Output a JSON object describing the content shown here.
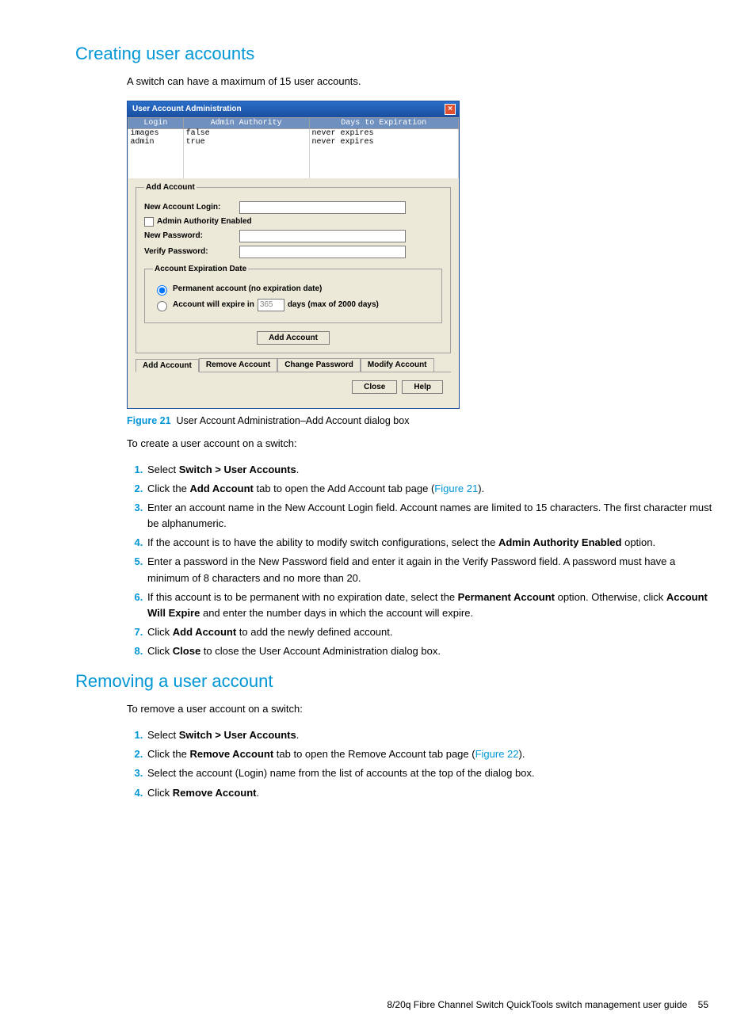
{
  "section1": {
    "heading": "Creating user accounts",
    "intro": "A switch can have a maximum of 15 user accounts."
  },
  "dialog": {
    "title": "User Account Administration",
    "columns": [
      "Login",
      "Admin Authority",
      "Days to Expiration"
    ],
    "rows": [
      {
        "login": "images",
        "auth": "false",
        "exp": "never expires"
      },
      {
        "login": "admin",
        "auth": "true",
        "exp": "never expires"
      }
    ],
    "addAccountLegend": "Add Account",
    "newLoginLabel": "New Account Login:",
    "adminAuthLabel": "Admin Authority Enabled",
    "newPasswordLabel": "New Password:",
    "verifyPasswordLabel": "Verify Password:",
    "expLegend": "Account Expiration Date",
    "permanentLabel": "Permanent account (no expiration date)",
    "expireLabel": "Account will expire in",
    "daysDefault": "365",
    "daysMax": "days (max of 2000 days)",
    "addButton": "Add Account",
    "tabs": [
      "Add Account",
      "Remove Account",
      "Change Password",
      "Modify Account"
    ],
    "closeBtn": "Close",
    "helpBtn": "Help"
  },
  "figure": {
    "num": "Figure 21",
    "caption": "User Account Administration–Add Account dialog box"
  },
  "create": {
    "toText": "To create a user account on a switch:",
    "step1_a": "Select ",
    "step1_b": "Switch > User Accounts",
    "step1_c": ".",
    "step2_a": "Click the ",
    "step2_b": "Add Account",
    "step2_c": " tab to open the Add Account tab page (",
    "step2_link": "Figure 21",
    "step2_d": ").",
    "step3": "Enter an account name in the New Account Login field. Account names are limited to 15 characters. The first character must be alphanumeric.",
    "step4_a": "If the account is to have the ability to modify switch configurations, select the ",
    "step4_b": "Admin Authority Enabled",
    "step4_c": " option.",
    "step5": "Enter a password in the New Password field and enter it again in the Verify Password field. A password must have a minimum of 8 characters and no more than 20.",
    "step6_a": "If this account is to be permanent with no expiration date, select the ",
    "step6_b": "Permanent Account",
    "step6_c": " option. Otherwise, click ",
    "step6_d": "Account Will Expire",
    "step6_e": " and enter the number days in which the account will expire.",
    "step7_a": "Click ",
    "step7_b": "Add Account",
    "step7_c": " to add the newly defined account.",
    "step8_a": "Click ",
    "step8_b": "Close",
    "step8_c": " to close the User Account Administration dialog box."
  },
  "section2": {
    "heading": "Removing a user account",
    "toText": "To remove a user account on a switch:",
    "step1_a": "Select ",
    "step1_b": "Switch > User Accounts",
    "step1_c": ".",
    "step2_a": "Click the ",
    "step2_b": "Remove Account",
    "step2_c": " tab to open the Remove Account tab page (",
    "step2_link": "Figure 22",
    "step2_d": ").",
    "step3": "Select the account (Login) name from the list of accounts at the top of the dialog box.",
    "step4_a": "Click ",
    "step4_b": "Remove Account",
    "step4_c": "."
  },
  "footer": {
    "text": "8/20q Fibre Channel Switch QuickTools switch management user guide",
    "page": "55"
  }
}
